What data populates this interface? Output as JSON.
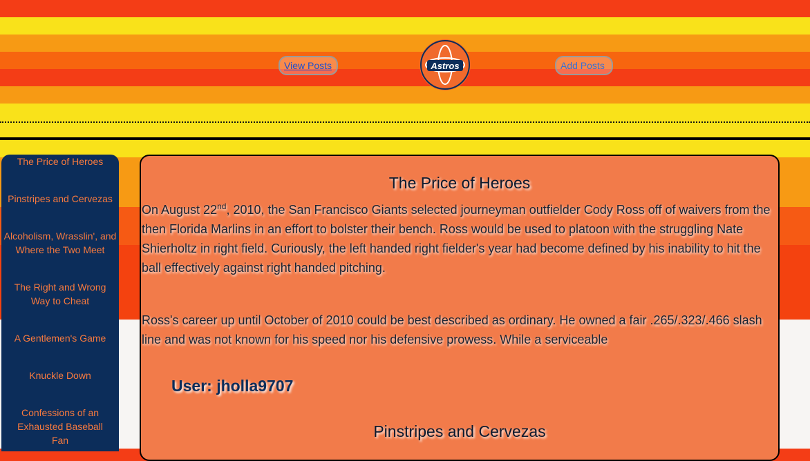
{
  "nav": {
    "view_posts": "View Posts",
    "add_posts": "Add Posts"
  },
  "logo": {
    "text": "Astros",
    "icon": "astros-logo"
  },
  "sidebar": {
    "items": [
      {
        "label": "The Price of Heroes"
      },
      {
        "label": "Pinstripes and Cervezas"
      },
      {
        "label": "Alcoholism, Wrasslin', and Where the Two Meet"
      },
      {
        "label": "The Right and Wrong Way to Cheat"
      },
      {
        "label": "A Gentlemen's Game"
      },
      {
        "label": "Knuckle Down"
      },
      {
        "label": "Confessions of an Exhausted Baseball Fan"
      }
    ]
  },
  "post1": {
    "title": "The Price of Heroes",
    "p1_before_sup": "On August 22",
    "p1_sup": "nd",
    "p1_after_sup": ", 2010, the San Francisco Giants selected journeyman outfielder Cody Ross off of waivers from the then Florida Marlins in an effort to bolster their bench. Ross would be used to platoon with the struggling Nate Shierholtz in right field. Curiously, the left handed right fielder's year had become defined by his inability to hit the ball effectively against right handed pitching.",
    "p2": "Ross's career up until October of 2010 could be best described as ordinary. He owned a fair .265/.323/.466 slash line and was not known for his speed nor his defensive prowess. While a serviceable",
    "user": "User: jholla9707"
  },
  "post2": {
    "title": "Pinstripes and Cervezas"
  },
  "colors": {
    "sidebar_bg": "#0c2d5a",
    "sidebar_text": "#f87a3e",
    "panel_bg": "#f27b4a"
  }
}
